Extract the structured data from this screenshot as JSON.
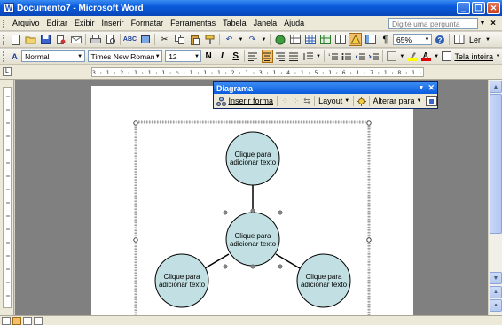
{
  "window": {
    "title": "Documento7 - Microsoft Word",
    "min": "_",
    "max": "❐",
    "close": "✕"
  },
  "menu": {
    "items": [
      "Arquivo",
      "Editar",
      "Exibir",
      "Inserir",
      "Formatar",
      "Ferramentas",
      "Tabela",
      "Janela",
      "Ajuda"
    ],
    "help_placeholder": "Digite uma pergunta",
    "close_label": "×"
  },
  "standard_toolbar": {
    "zoom": "65%",
    "read_label": "Ler"
  },
  "format_toolbar": {
    "style": "Normal",
    "font": "Times New Roman",
    "size": "12",
    "bold": "N",
    "italic": "I",
    "underline": "S",
    "fullscreen_label": "Tela inteira"
  },
  "ruler": {
    "h_text": "3 · 1 · 2 · 1 · 1 · 1 · ⌂ · 1 · 1 · 1 · 2 · 1 · 3 · 1 · 4 · 1 · 5 · 1 · 6 · 1 · 7 · 1 · 8 · 1 · 9 · 1 · 10 · 1 · 11 · 1 · 12 · 1 · 13 · 1 · 14 · 1 · 15 · 1 · 16 · 1 · 17 · 1"
  },
  "diagram_toolbar": {
    "title": "Diagrama",
    "insert_shape": "Inserir forma",
    "layout": "Layout",
    "change_to": "Alterar para"
  },
  "diagram": {
    "node_text_line1": "Clique para",
    "node_text_line2": "adicionar texto",
    "fill_color": "#c2e0e3"
  }
}
